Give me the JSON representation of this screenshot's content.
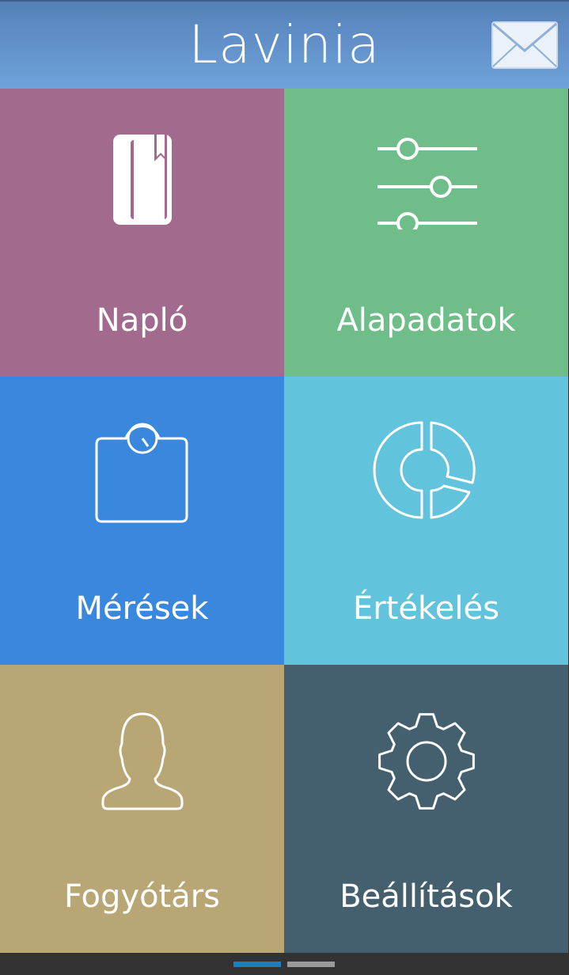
{
  "header": {
    "title": "Lavinia",
    "mail_icon": "envelope-icon"
  },
  "tiles": [
    {
      "label": "Napló",
      "icon": "diary-book-icon",
      "color": "#a26a8c"
    },
    {
      "label": "Alapadatok",
      "icon": "sliders-icon",
      "color": "#6fbd89"
    },
    {
      "label": "Mérések",
      "icon": "weighing-scale-icon",
      "color": "#3a88de"
    },
    {
      "label": "Értékelés",
      "icon": "donut-chart-icon",
      "color": "#62c4dc"
    },
    {
      "label": "Fogyótárs",
      "icon": "user-icon",
      "color": "#b8a674"
    },
    {
      "label": "Beállítások",
      "icon": "gear-icon",
      "color": "#445f6d"
    }
  ],
  "pager": {
    "active_color": "#1a7fbf",
    "inactive_color": "#9a9a9a",
    "pages": 2,
    "current": 1
  }
}
